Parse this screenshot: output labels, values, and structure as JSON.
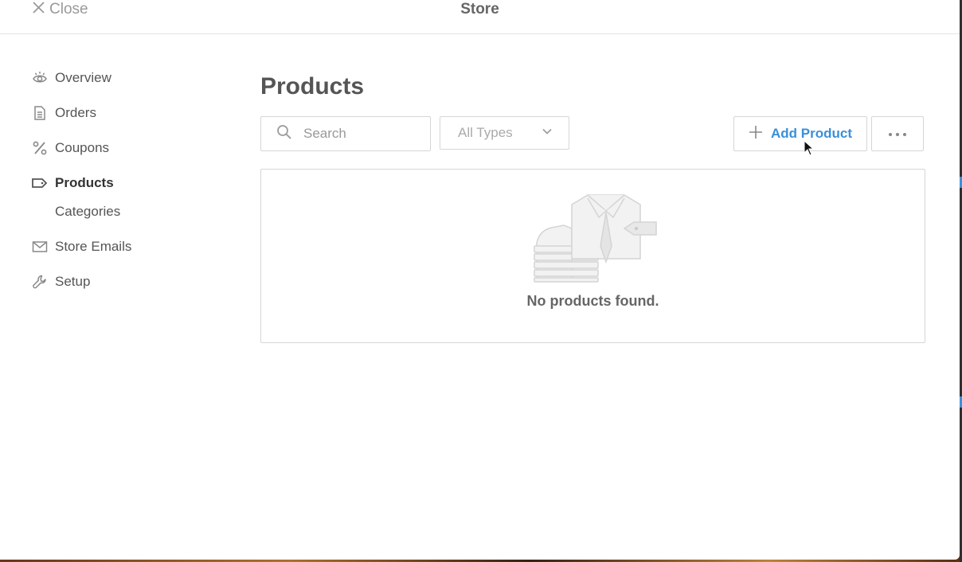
{
  "header": {
    "close_label": "Close",
    "title": "Store"
  },
  "sidebar": {
    "items": [
      {
        "label": "Overview",
        "icon": "eye-icon"
      },
      {
        "label": "Orders",
        "icon": "document-icon"
      },
      {
        "label": "Coupons",
        "icon": "percent-icon"
      },
      {
        "label": "Products",
        "icon": "tag-icon",
        "active": true
      },
      {
        "label": "Categories",
        "sub": true
      },
      {
        "label": "Store Emails",
        "icon": "envelope-icon"
      },
      {
        "label": "Setup",
        "icon": "wrench-icon"
      }
    ]
  },
  "main": {
    "title": "Products",
    "search": {
      "placeholder": "Search",
      "value": ""
    },
    "type_filter": {
      "selected": "All Types"
    },
    "add_button": "Add Product",
    "more_button_icon": "ellipsis-icon",
    "empty_state": {
      "message": "No products found.",
      "icon": "clothing-stack-icon"
    }
  },
  "colors": {
    "accent": "#3a8fd9",
    "text": "#555555",
    "border": "#d6d6d6"
  }
}
